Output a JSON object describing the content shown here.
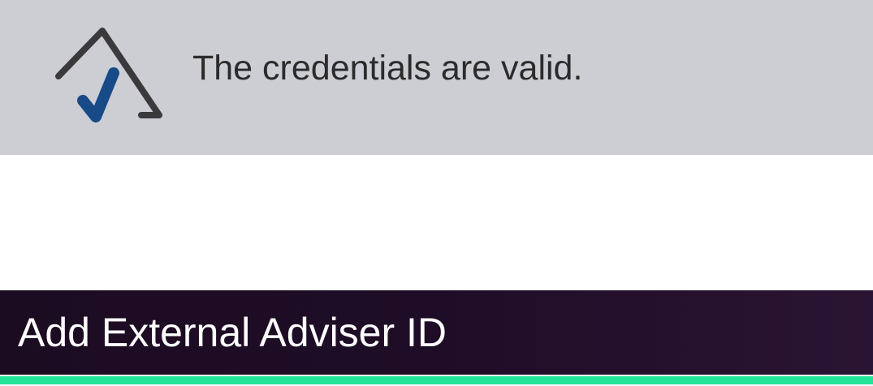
{
  "notification": {
    "icon": "check-triangle-icon",
    "message": "The credentials are valid."
  },
  "header": {
    "title": "Add External Adviser ID"
  },
  "colors": {
    "notice_bg": "#cdced3",
    "icon_outline": "#3a3a3c",
    "icon_check": "#174a86",
    "header_bg": "#1f0d27",
    "accent": "#22e59a"
  }
}
